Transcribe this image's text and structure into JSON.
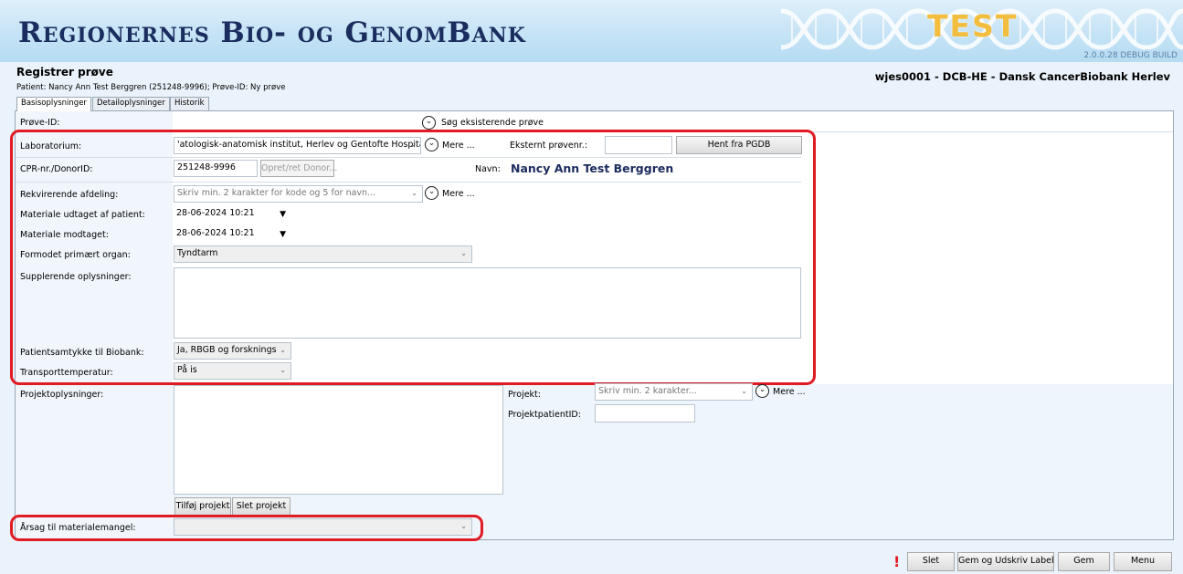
{
  "banner": {
    "title": "Regionernes Bio- og GenomBank",
    "test_label": "TEST",
    "build": "2.0.0.28 DEBUG BUILD"
  },
  "header": {
    "page_title": "Registrer prøve",
    "patient_line": "Patient: Nancy Ann Test Berggren (251248-9996); Prøve-ID: Ny prøve",
    "user_line": "wjes0001 - DCB-HE - Dansk CancerBiobank Herlev"
  },
  "tabs": [
    {
      "label": "Basisoplysninger",
      "active": true
    },
    {
      "label": "Detailoplysninger",
      "active": false
    },
    {
      "label": "Historik",
      "active": false
    }
  ],
  "form": {
    "prove_id_label": "Prøve-ID:",
    "search_existing_label": "Søg eksisterende prøve",
    "laboratorium_label": "Laboratorium:",
    "laboratorium_value": "'atologisk-anatomisk institut, Herlev og Gentofte Hospital",
    "more_label": "Mere ...",
    "external_no_label": "Eksternt prøvenr.:",
    "external_no_value": "",
    "fetch_pgdb_label": "Hent fra PGDB",
    "cpr_label": "CPR-nr./DonorID:",
    "cpr_value": "251248-9996",
    "create_donor_label": "Opret/ret Donor...",
    "name_label": "Navn:",
    "name_value": "Nancy Ann Test Berggren",
    "requisition_label": "Rekvirerende afdeling:",
    "requisition_placeholder": "Skriv min. 2 karakter for kode og 5 for navn...",
    "taken_label": "Materiale udtaget af patient:",
    "taken_value": "28-06-2024 10:21",
    "received_label": "Materiale modtaget:",
    "received_value": "28-06-2024 10:21",
    "organ_label": "Formodet primært organ:",
    "organ_value": "Tyndtarm",
    "extra_info_label": "Supplerende oplysninger:",
    "extra_info_value": "",
    "consent_label": "Patientsamtykke til Biobank:",
    "consent_value": "Ja, RBGB og forsknings",
    "transport_label": "Transporttemperatur:",
    "transport_value": "På is",
    "project_info_label": "Projektoplysninger:",
    "project_label": "Projekt:",
    "project_placeholder": "Skriv min. 2 karakter...",
    "project_patient_label": "ProjektpatientID:",
    "add_project_label": "Tilføj projekt",
    "delete_project_label": "Slet projekt",
    "shortage_label": "Årsag til materialemangel:",
    "shortage_value": ""
  },
  "footer": {
    "warning_mark": "!",
    "delete_label": "Slet",
    "save_print_label": "Gem og Udskriv Label",
    "save_label": "Gem",
    "menu_label": "Menu"
  },
  "colors": {
    "title_navy": "#1b2c5e",
    "highlight_red": "#e01b24",
    "test_gold": "#f3bd3f"
  }
}
